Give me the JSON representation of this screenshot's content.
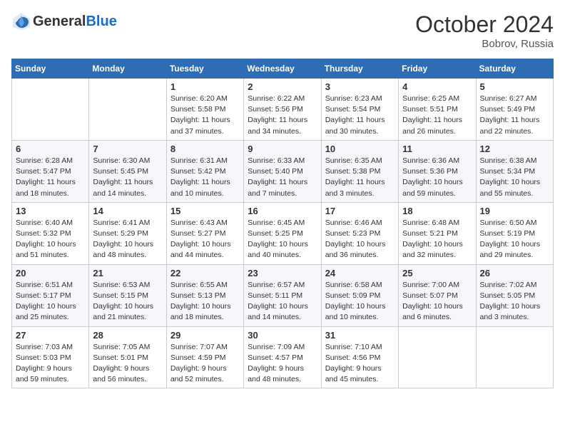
{
  "header": {
    "logo_general": "General",
    "logo_blue": "Blue",
    "month_year": "October 2024",
    "location": "Bobrov, Russia"
  },
  "weekdays": [
    "Sunday",
    "Monday",
    "Tuesday",
    "Wednesday",
    "Thursday",
    "Friday",
    "Saturday"
  ],
  "weeks": [
    [
      {
        "day": "",
        "detail": ""
      },
      {
        "day": "",
        "detail": ""
      },
      {
        "day": "1",
        "detail": "Sunrise: 6:20 AM\nSunset: 5:58 PM\nDaylight: 11 hours and 37 minutes."
      },
      {
        "day": "2",
        "detail": "Sunrise: 6:22 AM\nSunset: 5:56 PM\nDaylight: 11 hours and 34 minutes."
      },
      {
        "day": "3",
        "detail": "Sunrise: 6:23 AM\nSunset: 5:54 PM\nDaylight: 11 hours and 30 minutes."
      },
      {
        "day": "4",
        "detail": "Sunrise: 6:25 AM\nSunset: 5:51 PM\nDaylight: 11 hours and 26 minutes."
      },
      {
        "day": "5",
        "detail": "Sunrise: 6:27 AM\nSunset: 5:49 PM\nDaylight: 11 hours and 22 minutes."
      }
    ],
    [
      {
        "day": "6",
        "detail": "Sunrise: 6:28 AM\nSunset: 5:47 PM\nDaylight: 11 hours and 18 minutes."
      },
      {
        "day": "7",
        "detail": "Sunrise: 6:30 AM\nSunset: 5:45 PM\nDaylight: 11 hours and 14 minutes."
      },
      {
        "day": "8",
        "detail": "Sunrise: 6:31 AM\nSunset: 5:42 PM\nDaylight: 11 hours and 10 minutes."
      },
      {
        "day": "9",
        "detail": "Sunrise: 6:33 AM\nSunset: 5:40 PM\nDaylight: 11 hours and 7 minutes."
      },
      {
        "day": "10",
        "detail": "Sunrise: 6:35 AM\nSunset: 5:38 PM\nDaylight: 11 hours and 3 minutes."
      },
      {
        "day": "11",
        "detail": "Sunrise: 6:36 AM\nSunset: 5:36 PM\nDaylight: 10 hours and 59 minutes."
      },
      {
        "day": "12",
        "detail": "Sunrise: 6:38 AM\nSunset: 5:34 PM\nDaylight: 10 hours and 55 minutes."
      }
    ],
    [
      {
        "day": "13",
        "detail": "Sunrise: 6:40 AM\nSunset: 5:32 PM\nDaylight: 10 hours and 51 minutes."
      },
      {
        "day": "14",
        "detail": "Sunrise: 6:41 AM\nSunset: 5:29 PM\nDaylight: 10 hours and 48 minutes."
      },
      {
        "day": "15",
        "detail": "Sunrise: 6:43 AM\nSunset: 5:27 PM\nDaylight: 10 hours and 44 minutes."
      },
      {
        "day": "16",
        "detail": "Sunrise: 6:45 AM\nSunset: 5:25 PM\nDaylight: 10 hours and 40 minutes."
      },
      {
        "day": "17",
        "detail": "Sunrise: 6:46 AM\nSunset: 5:23 PM\nDaylight: 10 hours and 36 minutes."
      },
      {
        "day": "18",
        "detail": "Sunrise: 6:48 AM\nSunset: 5:21 PM\nDaylight: 10 hours and 32 minutes."
      },
      {
        "day": "19",
        "detail": "Sunrise: 6:50 AM\nSunset: 5:19 PM\nDaylight: 10 hours and 29 minutes."
      }
    ],
    [
      {
        "day": "20",
        "detail": "Sunrise: 6:51 AM\nSunset: 5:17 PM\nDaylight: 10 hours and 25 minutes."
      },
      {
        "day": "21",
        "detail": "Sunrise: 6:53 AM\nSunset: 5:15 PM\nDaylight: 10 hours and 21 minutes."
      },
      {
        "day": "22",
        "detail": "Sunrise: 6:55 AM\nSunset: 5:13 PM\nDaylight: 10 hours and 18 minutes."
      },
      {
        "day": "23",
        "detail": "Sunrise: 6:57 AM\nSunset: 5:11 PM\nDaylight: 10 hours and 14 minutes."
      },
      {
        "day": "24",
        "detail": "Sunrise: 6:58 AM\nSunset: 5:09 PM\nDaylight: 10 hours and 10 minutes."
      },
      {
        "day": "25",
        "detail": "Sunrise: 7:00 AM\nSunset: 5:07 PM\nDaylight: 10 hours and 6 minutes."
      },
      {
        "day": "26",
        "detail": "Sunrise: 7:02 AM\nSunset: 5:05 PM\nDaylight: 10 hours and 3 minutes."
      }
    ],
    [
      {
        "day": "27",
        "detail": "Sunrise: 7:03 AM\nSunset: 5:03 PM\nDaylight: 9 hours and 59 minutes."
      },
      {
        "day": "28",
        "detail": "Sunrise: 7:05 AM\nSunset: 5:01 PM\nDaylight: 9 hours and 56 minutes."
      },
      {
        "day": "29",
        "detail": "Sunrise: 7:07 AM\nSunset: 4:59 PM\nDaylight: 9 hours and 52 minutes."
      },
      {
        "day": "30",
        "detail": "Sunrise: 7:09 AM\nSunset: 4:57 PM\nDaylight: 9 hours and 48 minutes."
      },
      {
        "day": "31",
        "detail": "Sunrise: 7:10 AM\nSunset: 4:56 PM\nDaylight: 9 hours and 45 minutes."
      },
      {
        "day": "",
        "detail": ""
      },
      {
        "day": "",
        "detail": ""
      }
    ]
  ]
}
